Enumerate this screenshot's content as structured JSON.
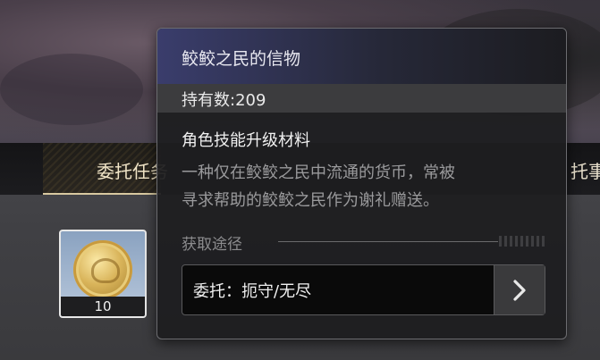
{
  "tabs": {
    "left_label": "委托任务",
    "right_label": "托事"
  },
  "item": {
    "icon": "coin-icon",
    "count": "10"
  },
  "tooltip": {
    "title": "鲛鲛之民的信物",
    "owned_label": "持有数:209",
    "category": "角色技能升级材料",
    "description_line1": "一种仅在鲛鲛之民中流通的货币，常被",
    "description_line2": "寻求帮助的鲛鲛之民作为谢礼赠送。",
    "source_label": "获取途径",
    "source_button_label": "委托：扼守/无尽",
    "source_arrow_icon": "chevron-right-icon"
  },
  "colors": {
    "header_accent": "#3a3d6c",
    "tab_underline": "#d8c9a0"
  }
}
